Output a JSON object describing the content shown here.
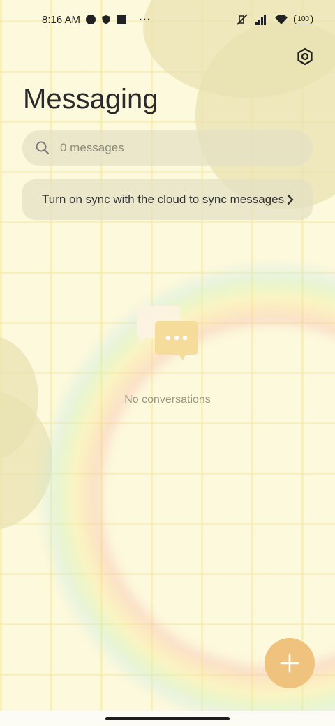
{
  "status_bar": {
    "time": "8:16 AM",
    "battery": "100",
    "icons": [
      "app-circle-icon",
      "shield-leaf-icon",
      "square-app-icon",
      "more-dots-icon",
      "mute-icon",
      "signal-icon",
      "wifi-icon",
      "battery-icon"
    ]
  },
  "header": {
    "title": "Messaging",
    "settings_icon": "settings-hex-icon"
  },
  "search": {
    "placeholder": "0 messages",
    "icon": "search-icon"
  },
  "sync_banner": {
    "text": "Turn on sync with the cloud to sync messages",
    "icon": "chevron-right-icon"
  },
  "empty_state": {
    "text": "No conversations",
    "icon": "chat-bubbles-icon"
  },
  "fab": {
    "icon": "plus-icon"
  },
  "colors": {
    "accent": "#efc27e",
    "background": "#fdf9dc"
  }
}
